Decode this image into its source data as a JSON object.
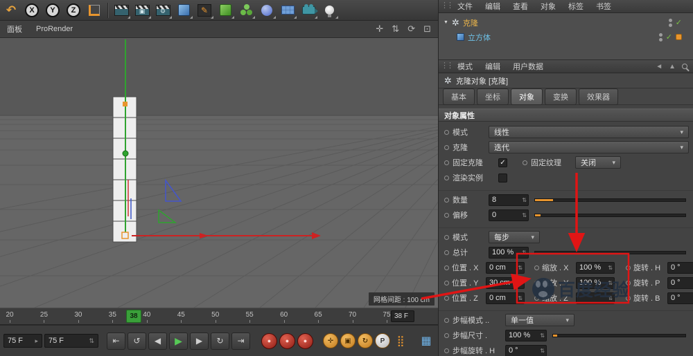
{
  "icons": {
    "undo": "↶",
    "pen": "✎",
    "gear": "⚙",
    "pan": "✛",
    "zoom": "⇅",
    "rotate_view": "⟳",
    "maximize": "⊡",
    "goto_start": "⇤",
    "loop": "↺",
    "prev_frame": "◀",
    "play": "▶",
    "next_frame": "▶",
    "cycle": "↻",
    "goto_end": "⇥",
    "record": "●",
    "key_move": "✛",
    "key_scale": "▣",
    "key_rotate": "↻",
    "pla_grid": "⣿",
    "panel_grid": "▦",
    "dropdown_arrow": "▾",
    "spinner": "⇅",
    "check": "✓",
    "grip": "⋮⋮",
    "expander": "▼",
    "cloner": "✲",
    "history_back": "◄",
    "filter_up": "▲",
    "range_step": "▸"
  },
  "toolbar": {
    "axis_x": "X",
    "axis_y": "Y",
    "axis_z": "Z"
  },
  "viewport": {
    "panel_menu": "面板",
    "renderer": "ProRender",
    "grid_spacing": "网格间距 : 100 cm"
  },
  "timeline": {
    "ticks": [
      "20",
      "25",
      "30",
      "35",
      "40",
      "45",
      "50",
      "55",
      "60",
      "65",
      "70",
      "75"
    ],
    "current_frame": "38",
    "frame_display": "38 F"
  },
  "transport": {
    "range_start": "75 F",
    "range_end": "75 F",
    "p_key": "P"
  },
  "object_manager": {
    "menu": [
      "文件",
      "编辑",
      "查看",
      "对象",
      "标签",
      "书签"
    ],
    "objects": [
      {
        "name": "克隆"
      },
      {
        "name": "立方体"
      }
    ]
  },
  "attribute_manager": {
    "menu": [
      "模式",
      "编辑",
      "用户数据"
    ],
    "title": "克隆对象 [克隆]",
    "tabs": [
      "基本",
      "坐标",
      "对象",
      "变换",
      "效果器"
    ],
    "active_tab": "对象",
    "section_title": "对象属性",
    "mode_label": "模式",
    "mode_value": "线性",
    "clones_label": "克隆",
    "clones_value": "迭代",
    "fix_clone_label": "固定克隆",
    "fix_texture_label": "固定纹理",
    "fix_texture_value": "关闭",
    "render_instances_label": "渲染实例",
    "count_label": "数量",
    "count_value": "8",
    "offset_label": "偏移",
    "offset_value": "0",
    "step_mode_label": "模式",
    "step_mode_value": "每步",
    "total_label": "总计",
    "total_value": "100 %",
    "position_x_label": "位置 . X",
    "position_x_value": "0 cm",
    "position_y_label": "位置 . Y",
    "position_y_value": "30 cm",
    "position_z_label": "位置 . Z",
    "position_z_value": "0 cm",
    "scale_x_label": "缩放 . X",
    "scale_x_value": "100 %",
    "scale_y_label": "缩放 . Y",
    "scale_y_value": "100 %",
    "scale_z_label": "缩放 . Z",
    "scale_z_value": "",
    "rotation_h_label": "旋转 . H",
    "rotation_h_value": "0 °",
    "rotation_p_label": "旋转 . P",
    "rotation_p_value": "0 °",
    "rotation_b_label": "旋转 . B",
    "rotation_b_value": "0 °",
    "step_mode2_label": "步幅模式 ..",
    "step_mode2_value": "单一值",
    "step_size_label": "步幅尺寸 .",
    "step_size_value": "100 %",
    "step_rotation_label": "步幅旋转 . H",
    "step_rotation_value": "0 °"
  },
  "watermark": {
    "text": "百度经验"
  },
  "colors": {
    "annotation_red": "#e01515",
    "accent_orange": "#e8952e",
    "axis_green": "#2fa32f",
    "axis_red": "#cc2222"
  }
}
